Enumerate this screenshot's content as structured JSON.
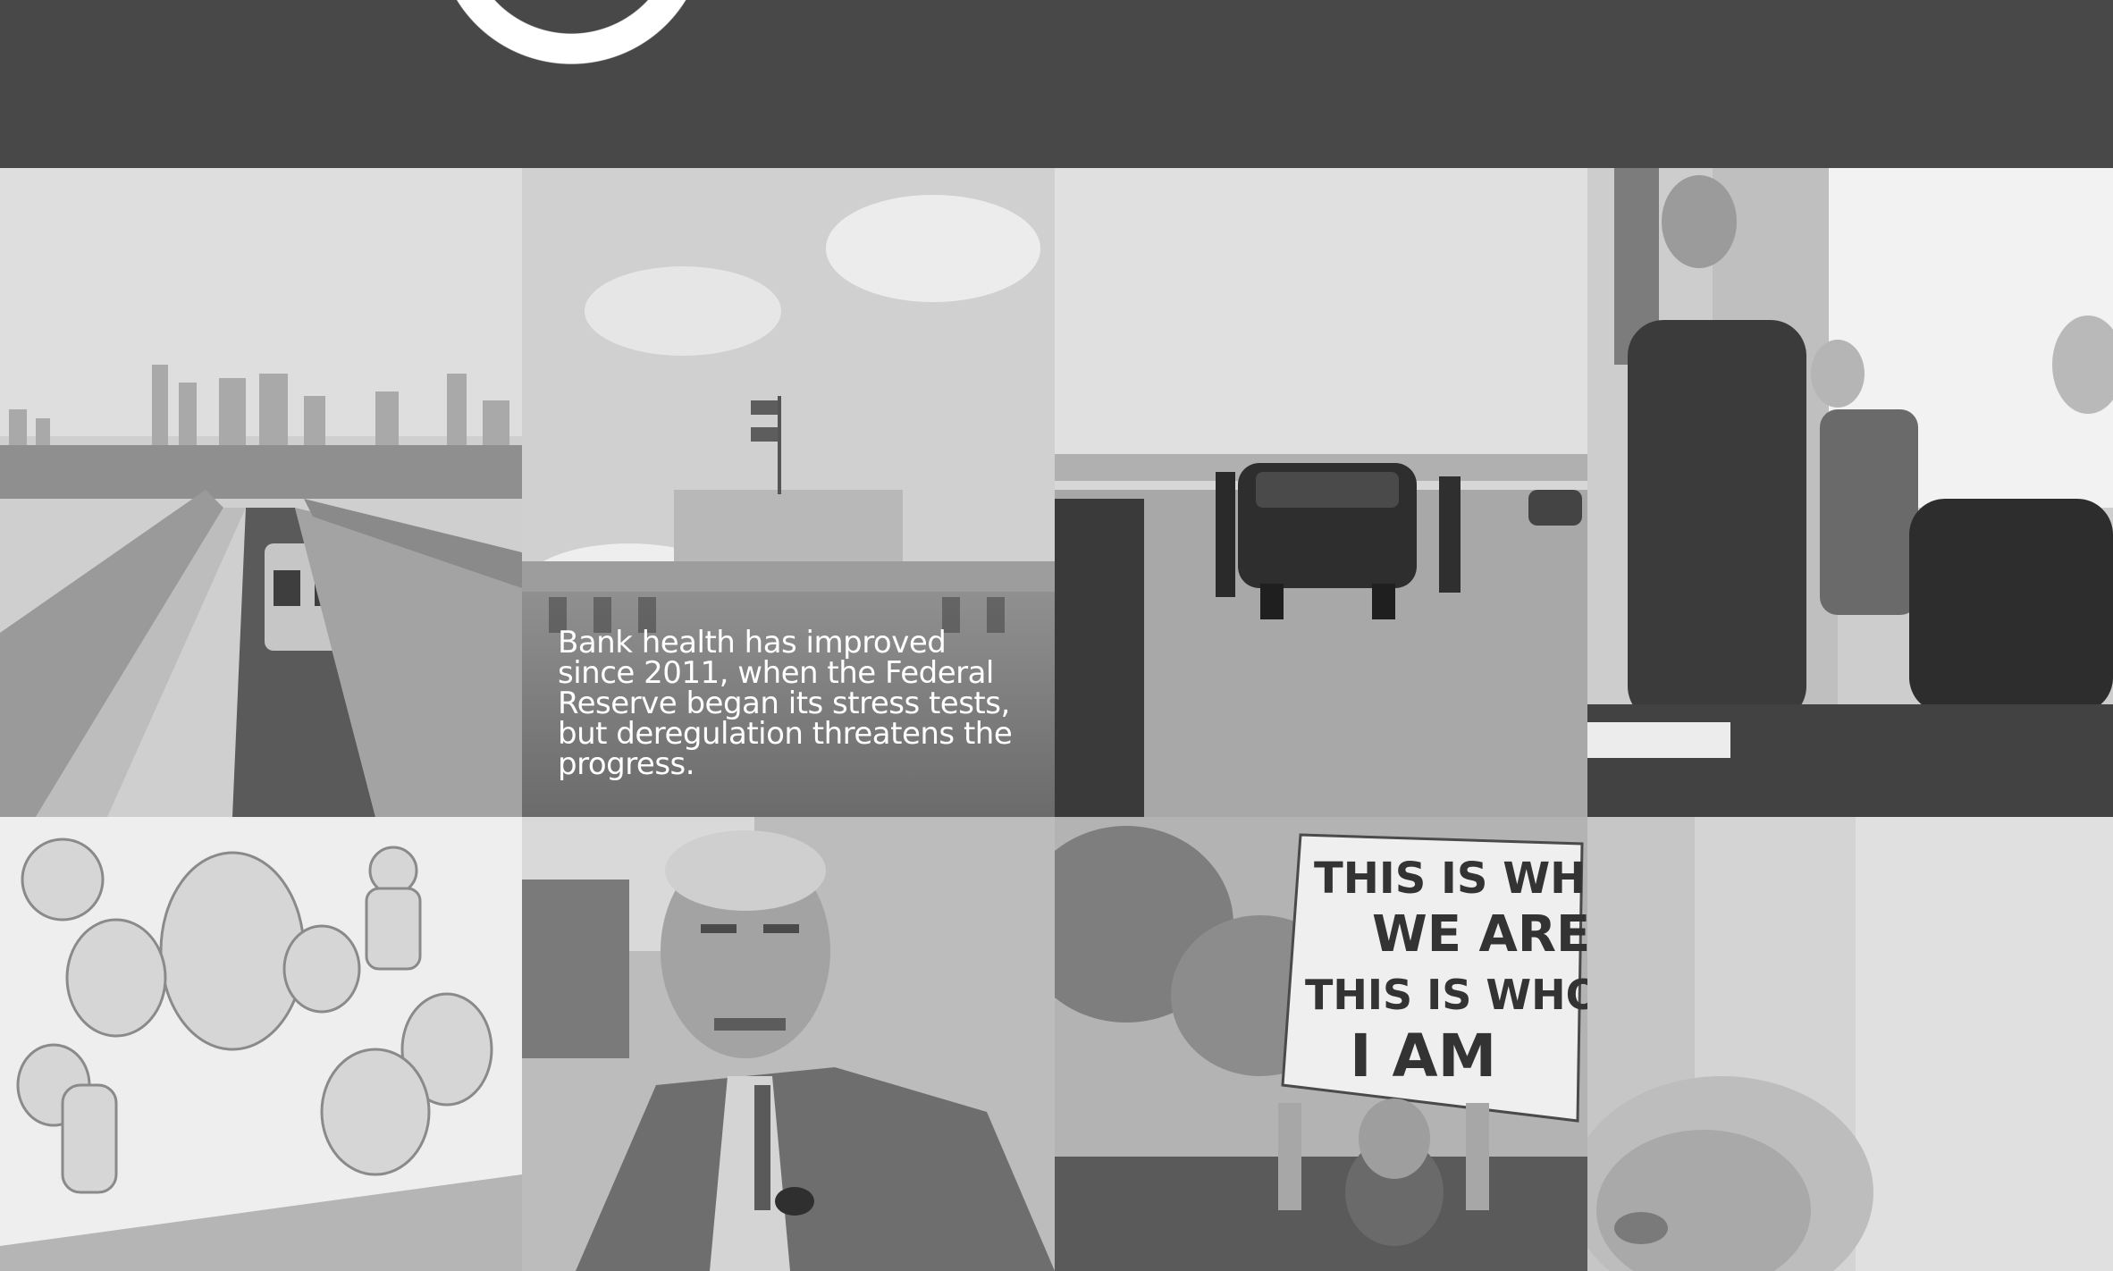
{
  "header": {
    "logo_icon": "circle-logo-icon"
  },
  "tiles": [
    {
      "subject": "elevated-train-skyline-photo"
    },
    {
      "subject": "federal-reserve-building-photo",
      "caption": "Bank health has improved since 2011, when the Federal Reserve began its stress tests, but deregulation threatens the progress."
    },
    {
      "subject": "motorcade-car-photo"
    },
    {
      "subject": "handshake-office-photo"
    },
    {
      "subject": "crowd-illustration"
    },
    {
      "subject": "man-with-pipe-photo"
    },
    {
      "subject": "protest-sign-photo",
      "sign_text": [
        "THIS IS WHO",
        "WE ARE",
        "THIS IS WHO",
        "I AM"
      ]
    },
    {
      "subject": "newborn-photo"
    }
  ]
}
